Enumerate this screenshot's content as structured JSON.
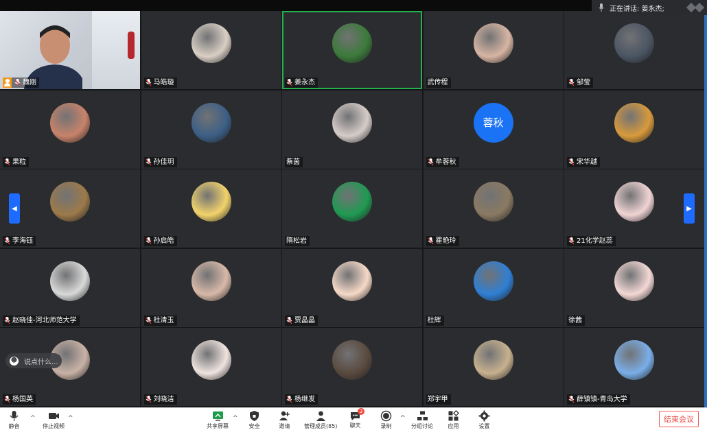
{
  "speaking": {
    "label": "正在讲话: 姜永杰;"
  },
  "participants": [
    {
      "name": "魏刚",
      "type": "video",
      "mic": true,
      "host": true
    },
    {
      "name": "马皓璇",
      "type": "avatar",
      "mic": true,
      "avatar_color": "#d9cfc4",
      "avatar_icon": "child-photo-avatar"
    },
    {
      "name": "姜永杰",
      "type": "avatar",
      "mic": true,
      "active": true,
      "avatar_color": "#3b7a3a",
      "avatar_icon": "plant-photo-avatar"
    },
    {
      "name": "武传程",
      "type": "avatar",
      "mic": false,
      "avatar_color": "#d7b5a3",
      "avatar_icon": "cartoon-astronaut-avatar"
    },
    {
      "name": "邹莹",
      "type": "avatar",
      "mic": true,
      "avatar_color": "#4b5563",
      "avatar_icon": "girl-photo-avatar"
    },
    {
      "name": "果粒",
      "type": "avatar",
      "mic": true,
      "avatar_color": "#c8836a",
      "avatar_icon": "face-photo-avatar"
    },
    {
      "name": "孙佳玥",
      "type": "avatar",
      "mic": true,
      "avatar_color": "#3c5f86",
      "avatar_icon": "lake-photo-avatar"
    },
    {
      "name": "蔡茵",
      "type": "avatar",
      "mic": false,
      "avatar_color": "#d6ccc8",
      "avatar_icon": "girl-selfie-avatar"
    },
    {
      "name": "牟蓉秋",
      "type": "text",
      "mic": true,
      "avatar_text": "蓉秋",
      "avatar_color": "#1a73f5"
    },
    {
      "name": "宋华越",
      "type": "avatar",
      "mic": true,
      "avatar_color": "#d89a3c",
      "avatar_icon": "sunset-photo-avatar"
    },
    {
      "name": "李海钰",
      "type": "avatar",
      "mic": true,
      "avatar_color": "#9c7a4a",
      "avatar_icon": "rabbit-avatar"
    },
    {
      "name": "孙启皓",
      "type": "avatar",
      "mic": true,
      "avatar_color": "#f2d36b",
      "avatar_icon": "cartoon-boy-avatar"
    },
    {
      "name": "隋松岩",
      "type": "avatar",
      "mic": false,
      "avatar_color": "#1f9a52",
      "avatar_icon": "university-logo-avatar"
    },
    {
      "name": "瞿艳玲",
      "type": "avatar",
      "mic": true,
      "avatar_color": "#8a7a62",
      "avatar_icon": "library-photo-avatar"
    },
    {
      "name": "21化学赵蕊",
      "type": "avatar",
      "mic": true,
      "avatar_color": "#f1d4d4",
      "avatar_icon": "child-girl-avatar"
    },
    {
      "name": "赵晓佳-河北师范大学",
      "type": "avatar",
      "mic": true,
      "avatar_color": "#d9d9d9",
      "avatar_icon": "anime-sketch-avatar"
    },
    {
      "name": "杜清玉",
      "type": "avatar",
      "mic": true,
      "avatar_color": "#d8b9a8",
      "avatar_icon": "capybara-avatar"
    },
    {
      "name": "贾晶晶",
      "type": "avatar",
      "mic": true,
      "avatar_color": "#f6d9c7",
      "avatar_icon": "sheep-avatar"
    },
    {
      "name": "杜辉",
      "type": "avatar",
      "mic": false,
      "avatar_color": "#2f7fd4",
      "avatar_icon": "building-photo-avatar"
    },
    {
      "name": "徐茜",
      "type": "avatar",
      "mic": false,
      "avatar_color": "#f3d8d5",
      "avatar_icon": "anime-girl-avatar"
    },
    {
      "name": "杨国英",
      "type": "avatar",
      "mic": true,
      "avatar_color": "#c9b2a6",
      "avatar_icon": "drawn-girl-avatar"
    },
    {
      "name": "刘晓洁",
      "type": "avatar",
      "mic": true,
      "avatar_color": "#efe4df",
      "avatar_icon": "woman-portrait-avatar"
    },
    {
      "name": "杨继发",
      "type": "avatar",
      "mic": true,
      "avatar_color": "#5a4a3e",
      "avatar_icon": "man-photo-avatar"
    },
    {
      "name": "郑宇甲",
      "type": "avatar",
      "mic": false,
      "avatar_color": "#c7b18f",
      "avatar_icon": "map-avatar"
    },
    {
      "name": "薛镇镇-青岛大学",
      "type": "avatar",
      "mic": true,
      "avatar_color": "#7aaee8",
      "avatar_icon": "sky-photo-avatar"
    }
  ],
  "chat_bubble": {
    "placeholder": "说点什么..."
  },
  "toolbar": {
    "mute": "静音",
    "stop_video": "停止视频",
    "share_screen": "共享屏幕",
    "security": "安全",
    "invite": "邀请",
    "manage_members": "管理成员(85)",
    "chat": "聊天",
    "chat_badge": "3",
    "record": "录制",
    "breakout": "分组讨论",
    "apps": "应用",
    "settings": "设置",
    "end_meeting": "结束会议"
  },
  "colors": {
    "accent": "#1a73f5",
    "active_speaker": "#22b14c",
    "end_red": "#e7453c"
  }
}
